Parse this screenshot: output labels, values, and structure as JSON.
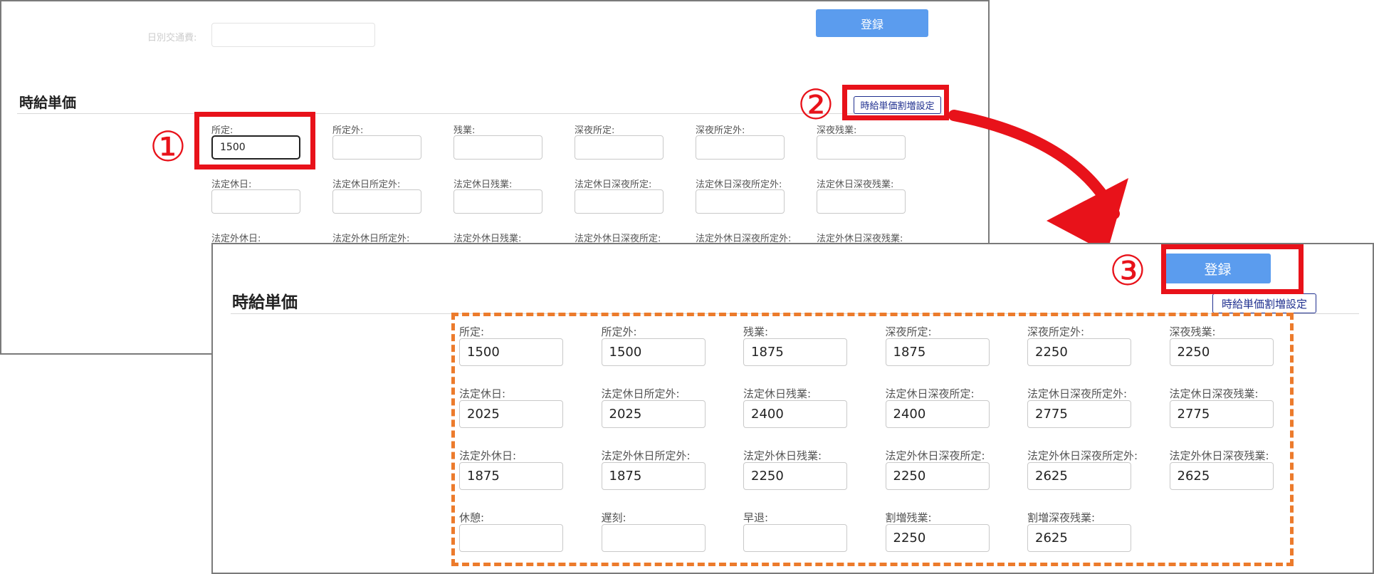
{
  "back_screen": {
    "commute_label": "日別交通費:",
    "commute_value": "",
    "register_button": "登録",
    "section_title": "時給単価",
    "surcharge_button": "時給単価割増設定",
    "rows": [
      [
        {
          "label": "所定:",
          "value": "1500"
        },
        {
          "label": "所定外:",
          "value": ""
        },
        {
          "label": "残業:",
          "value": ""
        },
        {
          "label": "深夜所定:",
          "value": ""
        },
        {
          "label": "深夜所定外:",
          "value": ""
        },
        {
          "label": "深夜残業:",
          "value": ""
        }
      ],
      [
        {
          "label": "法定休日:",
          "value": ""
        },
        {
          "label": "法定休日所定外:",
          "value": ""
        },
        {
          "label": "法定休日残業:",
          "value": ""
        },
        {
          "label": "法定休日深夜所定:",
          "value": ""
        },
        {
          "label": "法定休日深夜所定外:",
          "value": ""
        },
        {
          "label": "法定休日深夜残業:",
          "value": ""
        }
      ],
      [
        {
          "label": "法定外休日:",
          "value": ""
        },
        {
          "label": "法定外休日所定外:",
          "value": ""
        },
        {
          "label": "法定外休日残業:",
          "value": ""
        },
        {
          "label": "法定外休日深夜所定:",
          "value": ""
        },
        {
          "label": "法定外休日深夜所定外:",
          "value": ""
        },
        {
          "label": "法定外休日深夜残業:",
          "value": ""
        }
      ]
    ]
  },
  "front_screen": {
    "register_button": "登録",
    "section_title": "時給単価",
    "surcharge_button": "時給単価割増設定",
    "rows": [
      [
        {
          "label": "所定:",
          "value": "1500"
        },
        {
          "label": "所定外:",
          "value": "1500"
        },
        {
          "label": "残業:",
          "value": "1875"
        },
        {
          "label": "深夜所定:",
          "value": "1875"
        },
        {
          "label": "深夜所定外:",
          "value": "2250"
        },
        {
          "label": "深夜残業:",
          "value": "2250"
        }
      ],
      [
        {
          "label": "法定休日:",
          "value": "2025"
        },
        {
          "label": "法定休日所定外:",
          "value": "2025"
        },
        {
          "label": "法定休日残業:",
          "value": "2400"
        },
        {
          "label": "法定休日深夜所定:",
          "value": "2400"
        },
        {
          "label": "法定休日深夜所定外:",
          "value": "2775"
        },
        {
          "label": "法定休日深夜残業:",
          "value": "2775"
        }
      ],
      [
        {
          "label": "法定外休日:",
          "value": "1875"
        },
        {
          "label": "法定外休日所定外:",
          "value": "1875"
        },
        {
          "label": "法定外休日残業:",
          "value": "2250"
        },
        {
          "label": "法定外休日深夜所定:",
          "value": "2250"
        },
        {
          "label": "法定外休日深夜所定外:",
          "value": "2625"
        },
        {
          "label": "法定外休日深夜残業:",
          "value": "2625"
        }
      ],
      [
        {
          "label": "休憩:",
          "value": ""
        },
        {
          "label": "遅刻:",
          "value": ""
        },
        {
          "label": "早退:",
          "value": ""
        },
        {
          "label": "割増残業:",
          "value": "2250"
        },
        {
          "label": "割増深夜残業:",
          "value": "2625"
        }
      ]
    ]
  },
  "annotations": {
    "step1": "①",
    "step2": "②",
    "step3": "③"
  },
  "colors": {
    "highlight_red": "#e8121a",
    "dashed_orange": "#ec7b2c",
    "primary_button": "#5b9cee",
    "secondary_button_border": "#1f2f8f"
  }
}
